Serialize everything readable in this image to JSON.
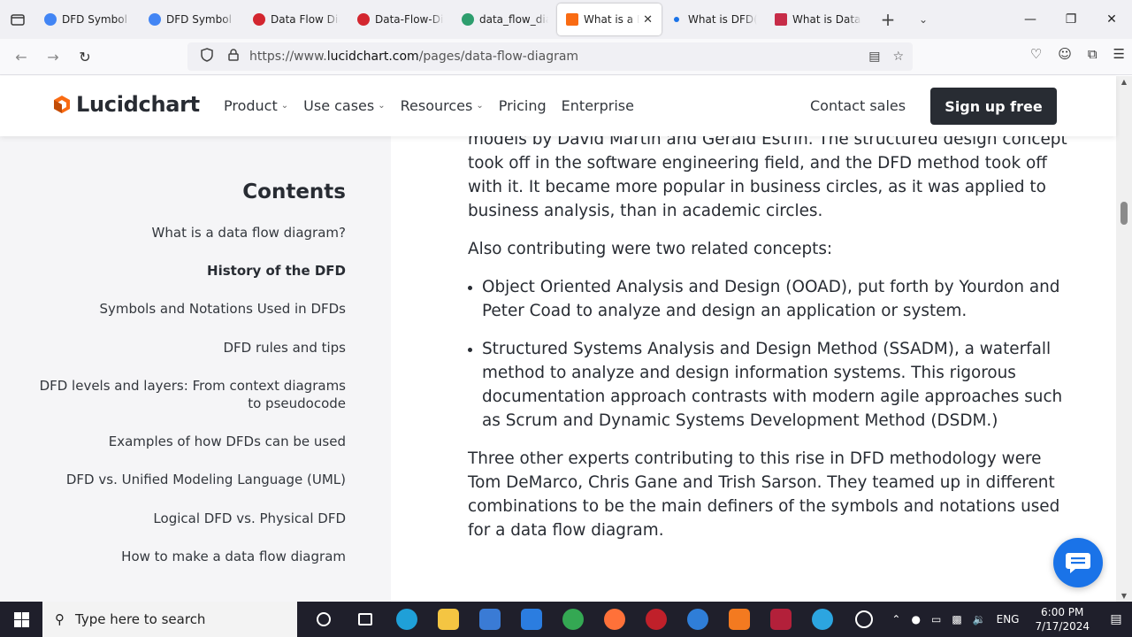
{
  "browser": {
    "tabs": [
      {
        "title": "DFD Symbol - ",
        "icon": "google-icon",
        "color": "#4285f4"
      },
      {
        "title": "DFD Symbol - ",
        "icon": "google-icon",
        "color": "#4285f4"
      },
      {
        "title": "Data Flow Diag",
        "icon": "opera-icon",
        "color": "#d3262f"
      },
      {
        "title": "Data-Flow-Dia",
        "icon": "opera-icon",
        "color": "#d3262f"
      },
      {
        "title": "data_flow_diag",
        "icon": "eye-icon",
        "color": "#2e9e6e"
      },
      {
        "title": "What is a Da",
        "icon": "lucidchart-icon",
        "color": "#f96b13",
        "active": true
      },
      {
        "title": "What is DFD(D",
        "icon": "dot-icon",
        "color": "#1a73e8"
      },
      {
        "title": "What is Data F",
        "icon": "diamond-icon",
        "color": "#c72c48"
      }
    ],
    "url_prefix": "https://www.",
    "url_host": "lucidchart.com",
    "url_path": "/pages/data-flow-diagram"
  },
  "site": {
    "logo_text": "Lucidchart",
    "nav": [
      {
        "label": "Product",
        "caret": true
      },
      {
        "label": "Use cases",
        "caret": true
      },
      {
        "label": "Resources",
        "caret": true
      },
      {
        "label": "Pricing",
        "caret": false
      },
      {
        "label": "Enterprise",
        "caret": false
      }
    ],
    "contact_label": "Contact sales",
    "signup_label": "Sign up free",
    "accent": "#282c33"
  },
  "toc": {
    "title": "Contents",
    "items": [
      {
        "label": "What is a data flow diagram?",
        "active": false
      },
      {
        "label": "History of the DFD",
        "active": true
      },
      {
        "label": "Symbols and Notations Used in DFDs",
        "active": false
      },
      {
        "label": "DFD rules and tips",
        "active": false
      },
      {
        "label": "DFD levels and layers: From context diagrams to pseudocode",
        "active": false
      },
      {
        "label": "Examples of how DFDs can be used",
        "active": false
      },
      {
        "label": "DFD vs. Unified Modeling Language (UML)",
        "active": false
      },
      {
        "label": "Logical DFD vs. Physical DFD",
        "active": false
      },
      {
        "label": "How to make a data flow diagram",
        "active": false
      }
    ]
  },
  "article": {
    "p1": "models by David Martin and Gerald Estrin. The structured design concept took off in the software engineering field, and the DFD method took off with it. It became more popular in business circles, as it was applied to business analysis, than in academic circles.",
    "p2": "Also contributing were two related concepts:",
    "bullets": [
      "Object Oriented Analysis and Design (OOAD), put forth by Yourdon and Peter Coad to analyze and design an application or system.",
      "Structured Systems Analysis and Design Method (SSADM), a waterfall method to analyze and design information systems. This rigorous documentation approach contrasts with modern agile approaches such as Scrum and Dynamic Systems Development Method (DSDM.)"
    ],
    "p3": "Three other experts contributing to this rise in DFD methodology were Tom DeMarco, Chris Gane and Trish Sarson. They teamed up in different combinations to be the main definers of the symbols and notations used for a data flow diagram."
  },
  "taskbar": {
    "search_placeholder": "Type here to search",
    "language": "ENG",
    "time": "6:00 PM",
    "date": "7/17/2024",
    "apps": [
      {
        "name": "cortana-icon",
        "color": "#ffffff"
      },
      {
        "name": "task-view-icon",
        "color": "#ffffff"
      },
      {
        "name": "edge-icon",
        "color": "#1fa0d8"
      },
      {
        "name": "file-explorer-icon",
        "color": "#f4c542"
      },
      {
        "name": "store-icon",
        "color": "#3a7bd5"
      },
      {
        "name": "mail-icon",
        "color": "#2b7de0"
      },
      {
        "name": "chrome-icon",
        "color": "#34a853"
      },
      {
        "name": "firefox-icon",
        "color": "#ff7139"
      },
      {
        "name": "app-red-icon",
        "color": "#c0202a"
      },
      {
        "name": "app-c-icon",
        "color": "#2f7ed8"
      },
      {
        "name": "xampp-icon",
        "color": "#f37a20"
      },
      {
        "name": "app-diamond-icon",
        "color": "#b3203a"
      },
      {
        "name": "telegram-icon",
        "color": "#2ca5e0"
      },
      {
        "name": "obs-icon",
        "color": "#ffffff"
      }
    ]
  }
}
